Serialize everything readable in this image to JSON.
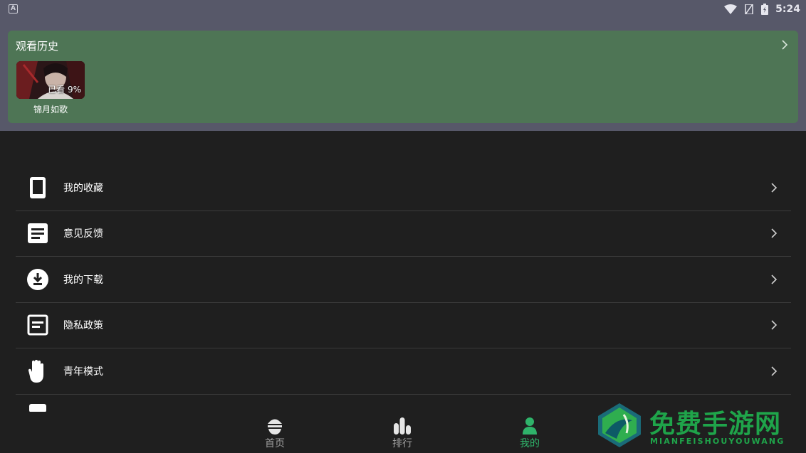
{
  "status_bar": {
    "time": "5:24",
    "left_icon": "A"
  },
  "history": {
    "title": "观看历史",
    "items": [
      {
        "name": "锦月如歌",
        "progress": "已看 9%"
      }
    ]
  },
  "menu": {
    "items": [
      {
        "label": "我的收藏",
        "icon": "phone-icon"
      },
      {
        "label": "意见反馈",
        "icon": "document-icon"
      },
      {
        "label": "我的下载",
        "icon": "download-icon"
      },
      {
        "label": "隐私政策",
        "icon": "policy-icon"
      },
      {
        "label": "青年模式",
        "icon": "hand-icon"
      }
    ]
  },
  "bottom_nav": {
    "items": [
      {
        "label": "首页",
        "icon": "home-icon",
        "active": false
      },
      {
        "label": "排行",
        "icon": "ranking-icon",
        "active": false
      },
      {
        "label": "我的",
        "icon": "profile-icon",
        "active": true
      }
    ]
  },
  "watermark": {
    "title": "免费手游网",
    "subtitle": "MIANFEISHOUYOUWANG"
  },
  "colors": {
    "accent": "#2fb36a",
    "card": "#4e7555",
    "header": "#575869",
    "background": "#1f1f1f"
  }
}
